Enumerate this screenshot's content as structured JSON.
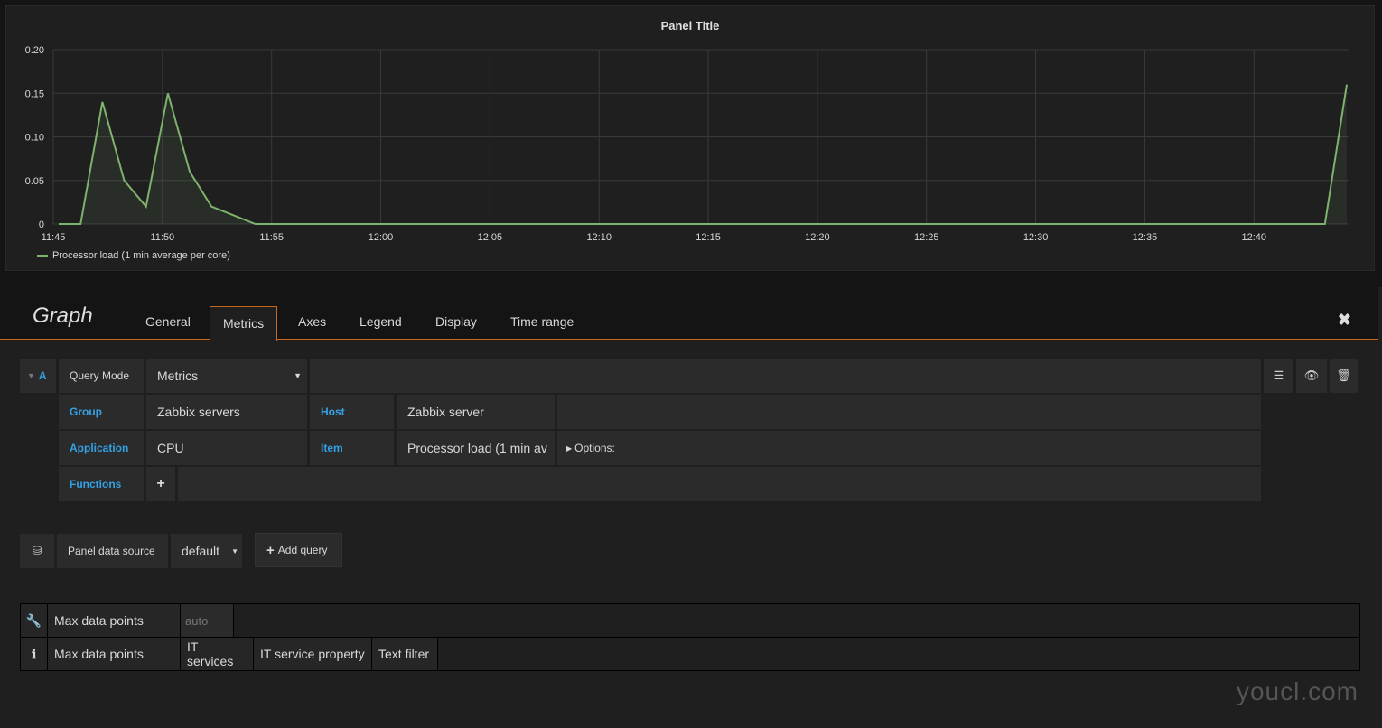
{
  "panel": {
    "title": "Panel Title"
  },
  "chart_data": {
    "type": "area",
    "title": "Panel Title",
    "x": [
      "11:45:15",
      "11:46:15",
      "11:47:15",
      "11:48:15",
      "11:49:15",
      "11:50:15",
      "11:51:15",
      "11:52:15",
      "11:53:15",
      "11:54:15",
      "12:43:15",
      "12:44:15"
    ],
    "series": [
      {
        "name": "Processor load (1 min average per core)",
        "values": [
          0,
          0,
          0.14,
          0.05,
          0.02,
          0.15,
          0.06,
          0.02,
          0.01,
          0,
          0,
          0.16
        ],
        "color": "#7eb26d"
      }
    ],
    "xlim": [
      "11:45:00",
      "12:44:20"
    ],
    "ylim": [
      0,
      0.2
    ],
    "yticks": [
      "0",
      "0.05",
      "0.10",
      "0.15",
      "0.20"
    ],
    "xticks": [
      "11:45",
      "11:50",
      "11:55",
      "12:00",
      "12:05",
      "12:10",
      "12:15",
      "12:20",
      "12:25",
      "12:30",
      "12:35",
      "12:40"
    ],
    "grid": true,
    "legend": "bottom-left"
  },
  "editor": {
    "title": "Graph",
    "tabs": [
      "General",
      "Metrics",
      "Axes",
      "Legend",
      "Display",
      "Time range"
    ],
    "active_tab": "Metrics",
    "close_icon": "close-icon"
  },
  "query": {
    "ref": "A",
    "query_mode_label": "Query Mode",
    "query_mode": "Metrics",
    "group_label": "Group",
    "group": "Zabbix servers",
    "host_label": "Host",
    "host": "Zabbix server",
    "application_label": "Application",
    "application": "CPU",
    "item_label": "Item",
    "item": "Processor load (1 min av",
    "options_label": "Options:",
    "functions_label": "Functions",
    "add_function": "+"
  },
  "datasource": {
    "label": "Panel data source",
    "value": "default",
    "add_query": "Add query"
  },
  "options": {
    "row1": {
      "label": "Max data points",
      "placeholder": "auto"
    },
    "row2": [
      "Max data points",
      "IT services",
      "IT service property",
      "Text filter"
    ]
  },
  "watermark": "youcl.com"
}
